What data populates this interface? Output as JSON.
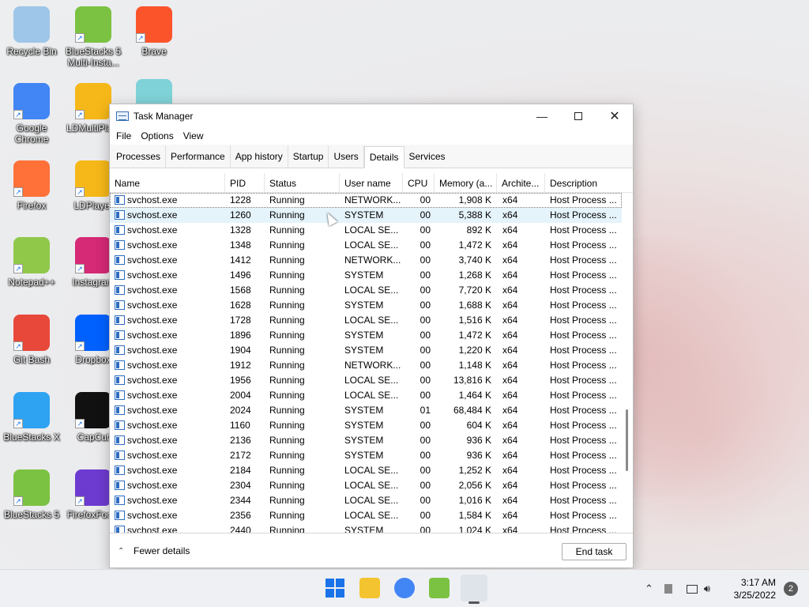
{
  "desktop": {
    "icons": [
      {
        "label": "Recycle Bin",
        "icon": "recycle-bin-icon",
        "color": "#9ec6e8"
      },
      {
        "label": "BlueStacks 5\nMulti-Insta...",
        "icon": "bluestacks-multi-icon",
        "color": "#7cc242"
      },
      {
        "label": "Brave",
        "icon": "brave-icon",
        "color": "#fb542b"
      },
      {
        "label": "Google\nChrome",
        "icon": "chrome-icon",
        "color": "#4285f4"
      },
      {
        "label": "LDMultiPla...",
        "icon": "ldmultiplayer-icon",
        "color": "#f6b818"
      },
      {
        "label": "",
        "icon": "cat-icon",
        "color": "#7fd3d8"
      },
      {
        "label": "Firefox",
        "icon": "firefox-icon",
        "color": "#ff7139"
      },
      {
        "label": "LDPlayer",
        "icon": "ldplayer-icon",
        "color": "#f6b818"
      },
      {
        "label": "Notepad++",
        "icon": "notepadpp-icon",
        "color": "#90c94a"
      },
      {
        "label": "Instagram",
        "icon": "instagram-icon",
        "color": "#d62976"
      },
      {
        "label": "Git Bash",
        "icon": "git-bash-icon",
        "color": "#e8483a"
      },
      {
        "label": "Dropbox",
        "icon": "dropbox-icon",
        "color": "#0061ff"
      },
      {
        "label": "BlueStacks X",
        "icon": "bluestacks-x-icon",
        "color": "#2ea3f2"
      },
      {
        "label": "CapCut",
        "icon": "capcut-icon",
        "color": "#111111"
      },
      {
        "label": "BlueStacks 5",
        "icon": "bluestacks5-icon",
        "color": "#7cc242"
      },
      {
        "label": "FirefoxFoc...",
        "icon": "firefox-focus-icon",
        "color": "#6e3bd1"
      }
    ]
  },
  "window": {
    "title": "Task Manager",
    "menu": [
      "File",
      "Options",
      "View"
    ],
    "tabs": [
      "Processes",
      "Performance",
      "App history",
      "Startup",
      "Users",
      "Details",
      "Services"
    ],
    "active_tab": "Details",
    "columns": [
      "Name",
      "PID",
      "Status",
      "User name",
      "CPU",
      "Memory (a...",
      "Archite...",
      "Description"
    ],
    "rows": [
      [
        "svchost.exe",
        "1228",
        "Running",
        "NETWORK...",
        "00",
        "1,908 K",
        "x64",
        "Host Process ..."
      ],
      [
        "svchost.exe",
        "1260",
        "Running",
        "SYSTEM",
        "00",
        "5,388 K",
        "x64",
        "Host Process ..."
      ],
      [
        "svchost.exe",
        "1328",
        "Running",
        "LOCAL SE...",
        "00",
        "892 K",
        "x64",
        "Host Process ..."
      ],
      [
        "svchost.exe",
        "1348",
        "Running",
        "LOCAL SE...",
        "00",
        "1,472 K",
        "x64",
        "Host Process ..."
      ],
      [
        "svchost.exe",
        "1412",
        "Running",
        "NETWORK...",
        "00",
        "3,740 K",
        "x64",
        "Host Process ..."
      ],
      [
        "svchost.exe",
        "1496",
        "Running",
        "SYSTEM",
        "00",
        "1,268 K",
        "x64",
        "Host Process ..."
      ],
      [
        "svchost.exe",
        "1568",
        "Running",
        "LOCAL SE...",
        "00",
        "7,720 K",
        "x64",
        "Host Process ..."
      ],
      [
        "svchost.exe",
        "1628",
        "Running",
        "SYSTEM",
        "00",
        "1,688 K",
        "x64",
        "Host Process ..."
      ],
      [
        "svchost.exe",
        "1728",
        "Running",
        "LOCAL SE...",
        "00",
        "1,516 K",
        "x64",
        "Host Process ..."
      ],
      [
        "svchost.exe",
        "1896",
        "Running",
        "SYSTEM",
        "00",
        "1,472 K",
        "x64",
        "Host Process ..."
      ],
      [
        "svchost.exe",
        "1904",
        "Running",
        "SYSTEM",
        "00",
        "1,220 K",
        "x64",
        "Host Process ..."
      ],
      [
        "svchost.exe",
        "1912",
        "Running",
        "NETWORK...",
        "00",
        "1,148 K",
        "x64",
        "Host Process ..."
      ],
      [
        "svchost.exe",
        "1956",
        "Running",
        "LOCAL SE...",
        "00",
        "13,816 K",
        "x64",
        "Host Process ..."
      ],
      [
        "svchost.exe",
        "2004",
        "Running",
        "LOCAL SE...",
        "00",
        "1,464 K",
        "x64",
        "Host Process ..."
      ],
      [
        "svchost.exe",
        "2024",
        "Running",
        "SYSTEM",
        "01",
        "68,484 K",
        "x64",
        "Host Process ..."
      ],
      [
        "svchost.exe",
        "1160",
        "Running",
        "SYSTEM",
        "00",
        "604 K",
        "x64",
        "Host Process ..."
      ],
      [
        "svchost.exe",
        "2136",
        "Running",
        "SYSTEM",
        "00",
        "936 K",
        "x64",
        "Host Process ..."
      ],
      [
        "svchost.exe",
        "2172",
        "Running",
        "SYSTEM",
        "00",
        "936 K",
        "x64",
        "Host Process ..."
      ],
      [
        "svchost.exe",
        "2184",
        "Running",
        "LOCAL SE...",
        "00",
        "1,252 K",
        "x64",
        "Host Process ..."
      ],
      [
        "svchost.exe",
        "2304",
        "Running",
        "LOCAL SE...",
        "00",
        "2,056 K",
        "x64",
        "Host Process ..."
      ],
      [
        "svchost.exe",
        "2344",
        "Running",
        "LOCAL SE...",
        "00",
        "1,016 K",
        "x64",
        "Host Process ..."
      ],
      [
        "svchost.exe",
        "2356",
        "Running",
        "LOCAL SE...",
        "00",
        "1,584 K",
        "x64",
        "Host Process ..."
      ],
      [
        "svchost.exe",
        "2440",
        "Running",
        "SYSTEM",
        "00",
        "1,024 K",
        "x64",
        "Host Process ..."
      ]
    ],
    "fewer_details": "Fewer details",
    "end_task": "End task"
  },
  "taskbar": {
    "time": "3:17 AM",
    "date": "3/25/2022",
    "notification_count": "2",
    "pinned": [
      {
        "icon": "windows-start-icon",
        "color": "#1a73e8"
      },
      {
        "icon": "file-explorer-icon",
        "color": "#f4c430"
      },
      {
        "icon": "chrome-icon",
        "color": "#4285f4"
      },
      {
        "icon": "bluestacks-icon",
        "color": "#7cc242"
      },
      {
        "icon": "task-manager-icon",
        "color": "#3a6fb3"
      }
    ]
  }
}
